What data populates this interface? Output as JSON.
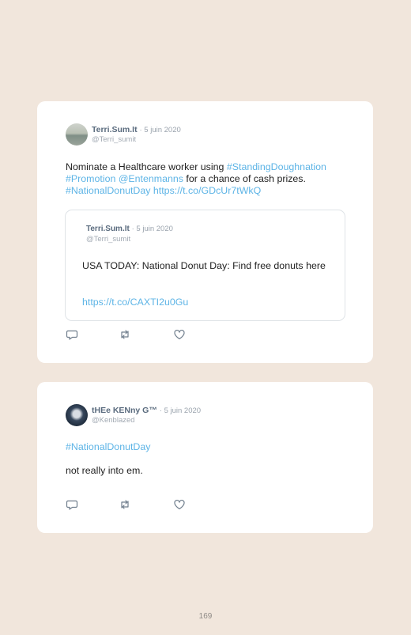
{
  "tweets": [
    {
      "name": "Terri.Sum.It",
      "date": "· 5 juin 2020",
      "handle": "@Terri_sumit",
      "text_segments": [
        {
          "text": "Nominate a Healthcare worker using ",
          "link": false
        },
        {
          "text": "#StandingDoughnation",
          "link": true
        },
        {
          "text": " ",
          "link": false
        },
        {
          "text": "#Promotion",
          "link": true
        },
        {
          "text": " ",
          "link": false
        },
        {
          "text": "@Entenmanns",
          "link": true
        },
        {
          "text": " for a chance of cash prizes. ",
          "link": false
        },
        {
          "text": "#NationalDonutDay",
          "link": true
        },
        {
          "text": " ",
          "link": false
        },
        {
          "text": "https://t.co/GDcUr7tWkQ",
          "link": true
        }
      ],
      "quote": {
        "name": "Terri.Sum.It",
        "date": "· 5 juin 2020",
        "handle": "@Terri_sumit",
        "text": "USA TODAY: National Donut Day: Find free donuts here",
        "link": "https://t.co/CAXTI2u0Gu"
      },
      "icons": [
        "reply-icon",
        "retweet-icon",
        "like-icon"
      ]
    },
    {
      "name": "tHEe KENny G™",
      "date": "· 5 juin 2020",
      "handle": "@Kenblazed",
      "hashtag": "#NationalDonutDay",
      "text": "not really into em.",
      "icons": [
        "reply-icon",
        "retweet-icon",
        "like-icon"
      ]
    }
  ],
  "page_number": "169",
  "colors": {
    "background": "#f1e6dc",
    "card": "#ffffff",
    "link": "#5db4e6",
    "name": "#5a6b7e",
    "meta": "#9aa3ad",
    "icon": "#6f7d8c"
  }
}
